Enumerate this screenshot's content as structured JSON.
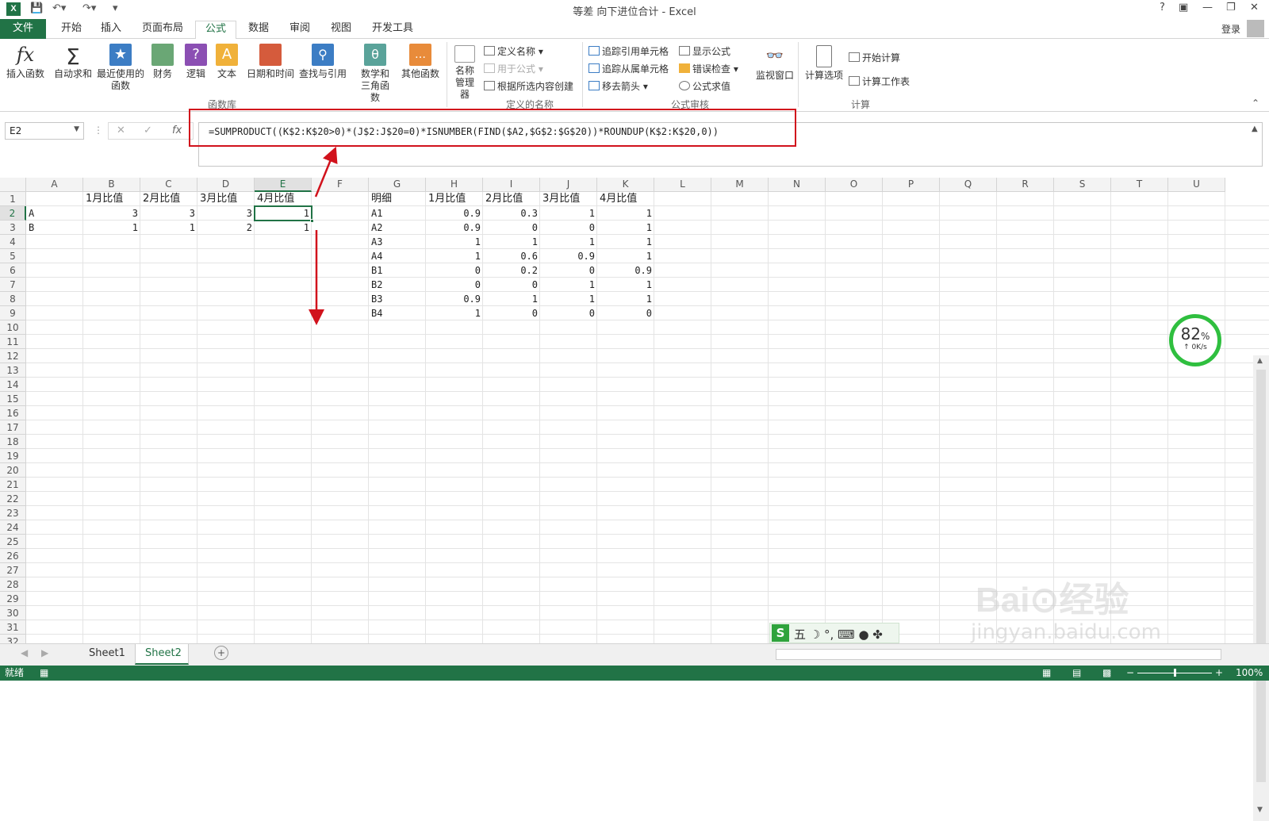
{
  "app": {
    "window_title": "等差 向下进位合计 - Excel",
    "logo": "X",
    "login_label": "登录",
    "help": "?",
    "window_controls": [
      "?",
      "▣",
      "—",
      "❐",
      "✕"
    ]
  },
  "tabs": [
    "文件",
    "开始",
    "插入",
    "页面布局",
    "公式",
    "数据",
    "审阅",
    "视图",
    "开发工具"
  ],
  "active_tab": "公式",
  "ribbon": {
    "big_buttons": [
      "插入函数",
      "自动求和",
      "最近使用的函数",
      "财务",
      "逻辑",
      "文本",
      "日期和时间",
      "查找与引用",
      "数学和三角函数",
      "其他函数"
    ],
    "name_manager": "名称管理器",
    "define_name": "定义名称",
    "use_in_formula": "用于公式",
    "create_from_selection": "根据所选内容创建",
    "trace_precedents": "追踪引用单元格",
    "trace_dependents": "追踪从属单元格",
    "remove_arrows": "移去箭头",
    "show_formulas": "显示公式",
    "error_checking": "错误检查",
    "evaluate_formula": "公式求值",
    "watch_window": "监视窗口",
    "calc_options": "计算选项",
    "calc_now": "开始计算",
    "calc_sheet": "计算工作表",
    "group_labels": [
      "函数库",
      "定义的名称",
      "公式审核",
      "计算"
    ]
  },
  "formula_bar": {
    "name_box": "E2",
    "fx": "fx",
    "formula": "=SUMPRODUCT((K$2:K$20>0)*(J$2:J$20=0)*ISNUMBER(FIND($A2,$G$2:$G$20))*ROUNDUP(K$2:K$20,0))"
  },
  "columns": [
    "A",
    "B",
    "C",
    "D",
    "E",
    "F",
    "G",
    "H",
    "I",
    "J",
    "K",
    "L",
    "M",
    "N",
    "O",
    "P",
    "Q",
    "R",
    "S",
    "T",
    "U"
  ],
  "selected_column": "E",
  "selected_row": 2,
  "row_numbers": [
    "1",
    "2",
    "3",
    "4",
    "5",
    "6",
    "7",
    "8",
    "9",
    "10",
    "11",
    "12",
    "13",
    "14",
    "15",
    "16",
    "17",
    "18",
    "19",
    "20",
    "21",
    "22",
    "23",
    "24",
    "25",
    "26",
    "27",
    "28",
    "29",
    "30",
    "31",
    "32"
  ],
  "table1": {
    "headers": [
      "",
      "1月比值",
      "2月比值",
      "3月比值",
      "4月比值"
    ],
    "rows": [
      [
        "A",
        "3",
        "3",
        "3",
        "1"
      ],
      [
        "B",
        "1",
        "1",
        "2",
        "1"
      ]
    ]
  },
  "table2": {
    "headers": [
      "明细",
      "1月比值",
      "2月比值",
      "3月比值",
      "4月比值"
    ],
    "rows": [
      [
        "A1",
        "0.9",
        "0.3",
        "1",
        "1"
      ],
      [
        "A2",
        "0.9",
        "0",
        "0",
        "1"
      ],
      [
        "A3",
        "1",
        "1",
        "1",
        "1"
      ],
      [
        "A4",
        "1",
        "0.6",
        "0.9",
        "1"
      ],
      [
        "B1",
        "0",
        "0.2",
        "0",
        "0.9"
      ],
      [
        "B2",
        "0",
        "0",
        "1",
        "1"
      ],
      [
        "B3",
        "0.9",
        "1",
        "1",
        "1"
      ],
      [
        "B4",
        "1",
        "0",
        "0",
        "0"
      ]
    ]
  },
  "overlay": {
    "gauge_percent": "82",
    "gauge_unit": "%",
    "gauge_speed": "↑ 0K/s",
    "ime": "五 ☽ °, ⌨ ● ✤",
    "watermark": "Bai⊙经验",
    "watermark_url": "jingyan.baidu.com"
  },
  "sheets": [
    "Sheet1",
    "Sheet2"
  ],
  "active_sheet": "Sheet2",
  "status": {
    "ready": "就绪",
    "zoom": "100%"
  },
  "accent_color": "#217346",
  "highlight_color": "#d1121c"
}
